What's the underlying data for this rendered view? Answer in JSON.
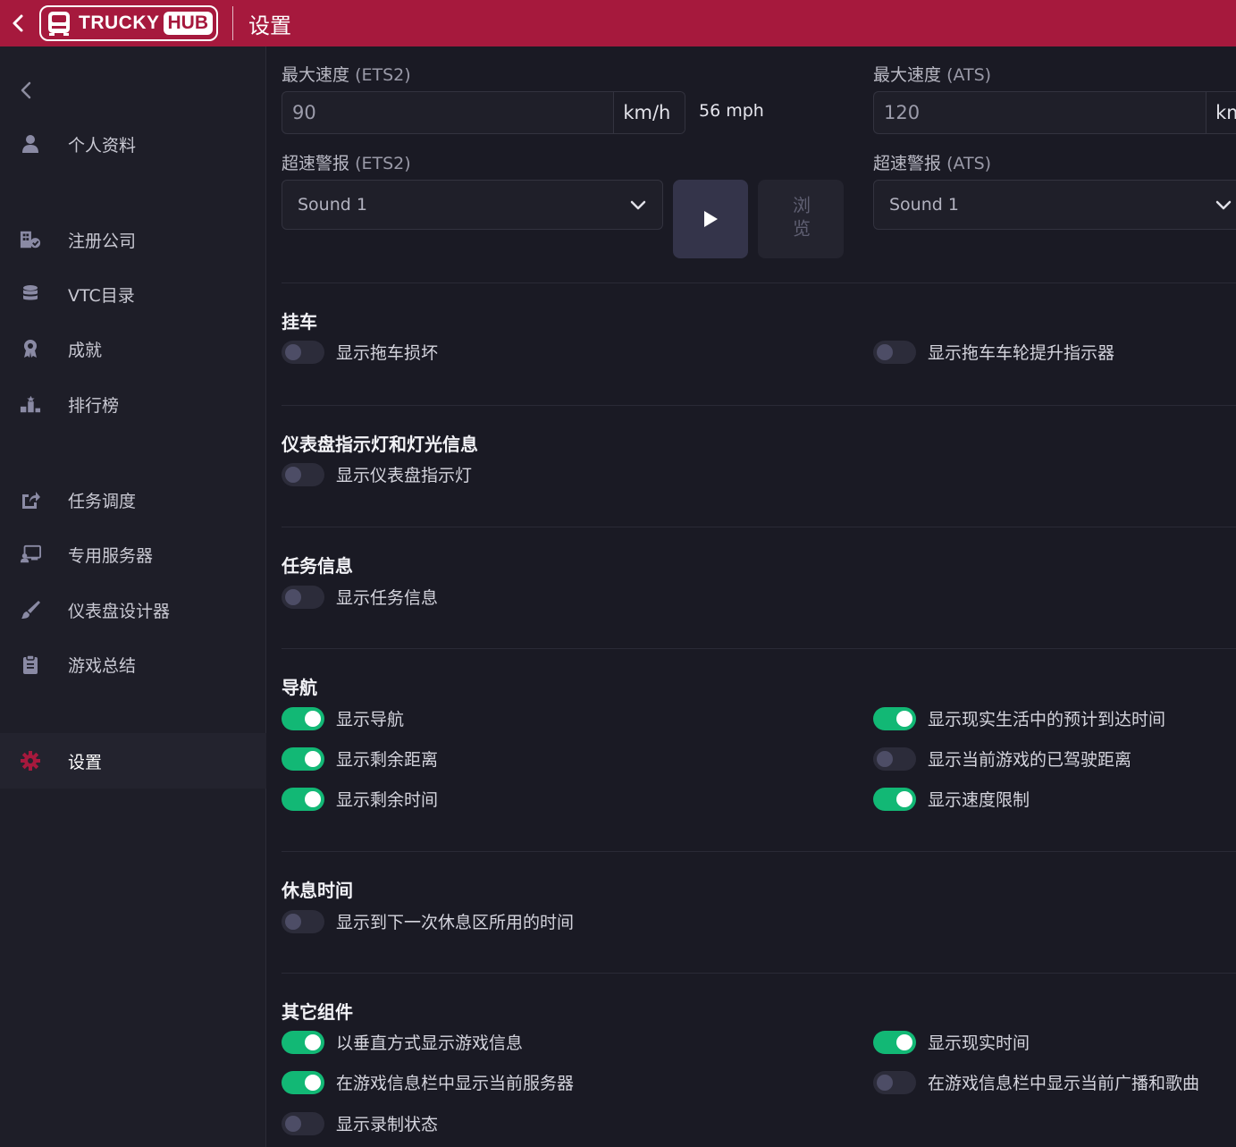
{
  "header": {
    "back_icon": "chevron-left-icon",
    "logo_word": "TRUCKY",
    "logo_hub": "HUB",
    "title": "设置"
  },
  "sidebar": {
    "collapse_icon": "chevron-left-icon",
    "items": [
      {
        "label": "个人资料",
        "icon": "user-icon"
      },
      {
        "label": "注册公司",
        "icon": "building-check-icon"
      },
      {
        "label": "VTC目录",
        "icon": "database-icon"
      },
      {
        "label": "成就",
        "icon": "award-icon"
      },
      {
        "label": "排行榜",
        "icon": "podium-icon"
      },
      {
        "label": "任务调度",
        "icon": "share-square-icon"
      },
      {
        "label": "专用服务器",
        "icon": "server-chalkboard-icon"
      },
      {
        "label": "仪表盘设计器",
        "icon": "paint-brush-icon"
      },
      {
        "label": "游戏总结",
        "icon": "clipboard-icon"
      },
      {
        "label": "设置",
        "icon": "gear-icon",
        "active": true
      }
    ]
  },
  "speed": {
    "ets2_label": "最大速度",
    "ets2_sub": "(ETS2)",
    "ets2_value": "90",
    "ets2_unit": "km/h",
    "ets2_mph": "56 mph",
    "ats_label": "最大速度",
    "ats_sub": "(ATS)",
    "ats_value": "120",
    "ats_unit": "km/h"
  },
  "alarm": {
    "ets2_label": "超速警报",
    "ets2_sub": "(ETS2)",
    "ets2_value": "Sound 1",
    "ats_label": "超速警报",
    "ats_sub": "(ATS)",
    "ats_value": "Sound 1",
    "play_icon": "play-icon",
    "browse_label": "浏览"
  },
  "sections": {
    "trailer": {
      "title": "挂车",
      "damage": {
        "label": "显示拖车损坏",
        "on": false
      },
      "axle": {
        "label": "显示拖车车轮提升指示器",
        "on": false
      }
    },
    "dashboard": {
      "title": "仪表盘指示灯和灯光信息",
      "lights": {
        "label": "显示仪表盘指示灯",
        "on": false
      }
    },
    "job": {
      "title": "任务信息",
      "info": {
        "label": "显示任务信息",
        "on": false
      }
    },
    "navigation": {
      "title": "导航",
      "nav": {
        "label": "显示导航",
        "on": true
      },
      "remaining_distance": {
        "label": "显示剩余距离",
        "on": true
      },
      "remaining_time": {
        "label": "显示剩余时间",
        "on": true
      },
      "real_eta": {
        "label": "显示现实生活中的预计到达时间",
        "on": true
      },
      "driven_distance": {
        "label": "显示当前游戏的已驾驶距离",
        "on": false
      },
      "speed_limit": {
        "label": "显示速度限制",
        "on": true
      }
    },
    "rest": {
      "title": "休息时间",
      "next_rest": {
        "label": "显示到下一次休息区所用的时间",
        "on": false
      }
    },
    "other": {
      "title": "其它组件",
      "vertical": {
        "label": "以垂直方式显示游戏信息",
        "on": true
      },
      "server": {
        "label": "在游戏信息栏中显示当前服务器",
        "on": true
      },
      "recording": {
        "label": "显示录制状态",
        "on": false
      },
      "real_time": {
        "label": "显示现实时间",
        "on": true
      },
      "radio": {
        "label": "在游戏信息栏中显示当前广播和歌曲",
        "on": false
      }
    }
  },
  "colors": {
    "brand": "#a6193d",
    "toggle_on": "#12b875",
    "toggle_off": "#2c2c3a"
  }
}
